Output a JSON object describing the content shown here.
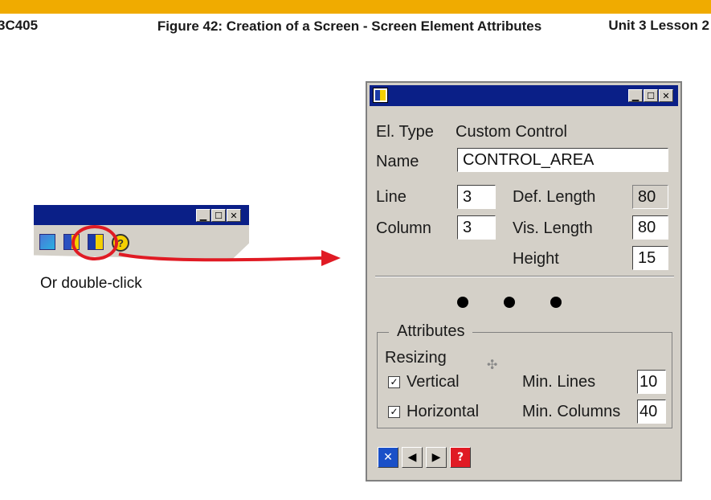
{
  "header": {
    "left": "3C405",
    "center": "Figure 42: Creation of a Screen - Screen Element Attributes",
    "right": "Unit 3 Lesson 2"
  },
  "mini_toolbar": {
    "window_buttons": [
      "minimize",
      "maximize",
      "close"
    ],
    "tools": [
      "screen-icon",
      "element-list-icon",
      "element-attributes-icon",
      "help-icon"
    ],
    "highlighted_tool": "element-attributes-icon",
    "highlight_color": "#e01b24"
  },
  "caption": "Or double-click",
  "dialog": {
    "el_type_label": "El. Type",
    "el_type_value": "Custom Control",
    "name_label": "Name",
    "name_value": "CONTROL_AREA",
    "line_label": "Line",
    "line_value": "3",
    "column_label": "Column",
    "column_value": "3",
    "def_length_label": "Def. Length",
    "def_length_value": "80",
    "vis_length_label": "Vis. Length",
    "vis_length_value": "80",
    "height_label": "Height",
    "height_value": "15",
    "attributes_title": "Attributes",
    "resizing_label": "Resizing",
    "vertical_label": "Vertical",
    "vertical_checked": true,
    "horizontal_label": "Horizontal",
    "horizontal_checked": true,
    "min_lines_label": "Min. Lines",
    "min_lines_value": "10",
    "min_columns_label": "Min. Columns",
    "min_columns_value": "40"
  },
  "colors": {
    "accent_bar": "#f0ab00",
    "titlebar": "#0a1f87",
    "dialog_bg": "#d4d0c8",
    "arrow": "#e01b24"
  }
}
